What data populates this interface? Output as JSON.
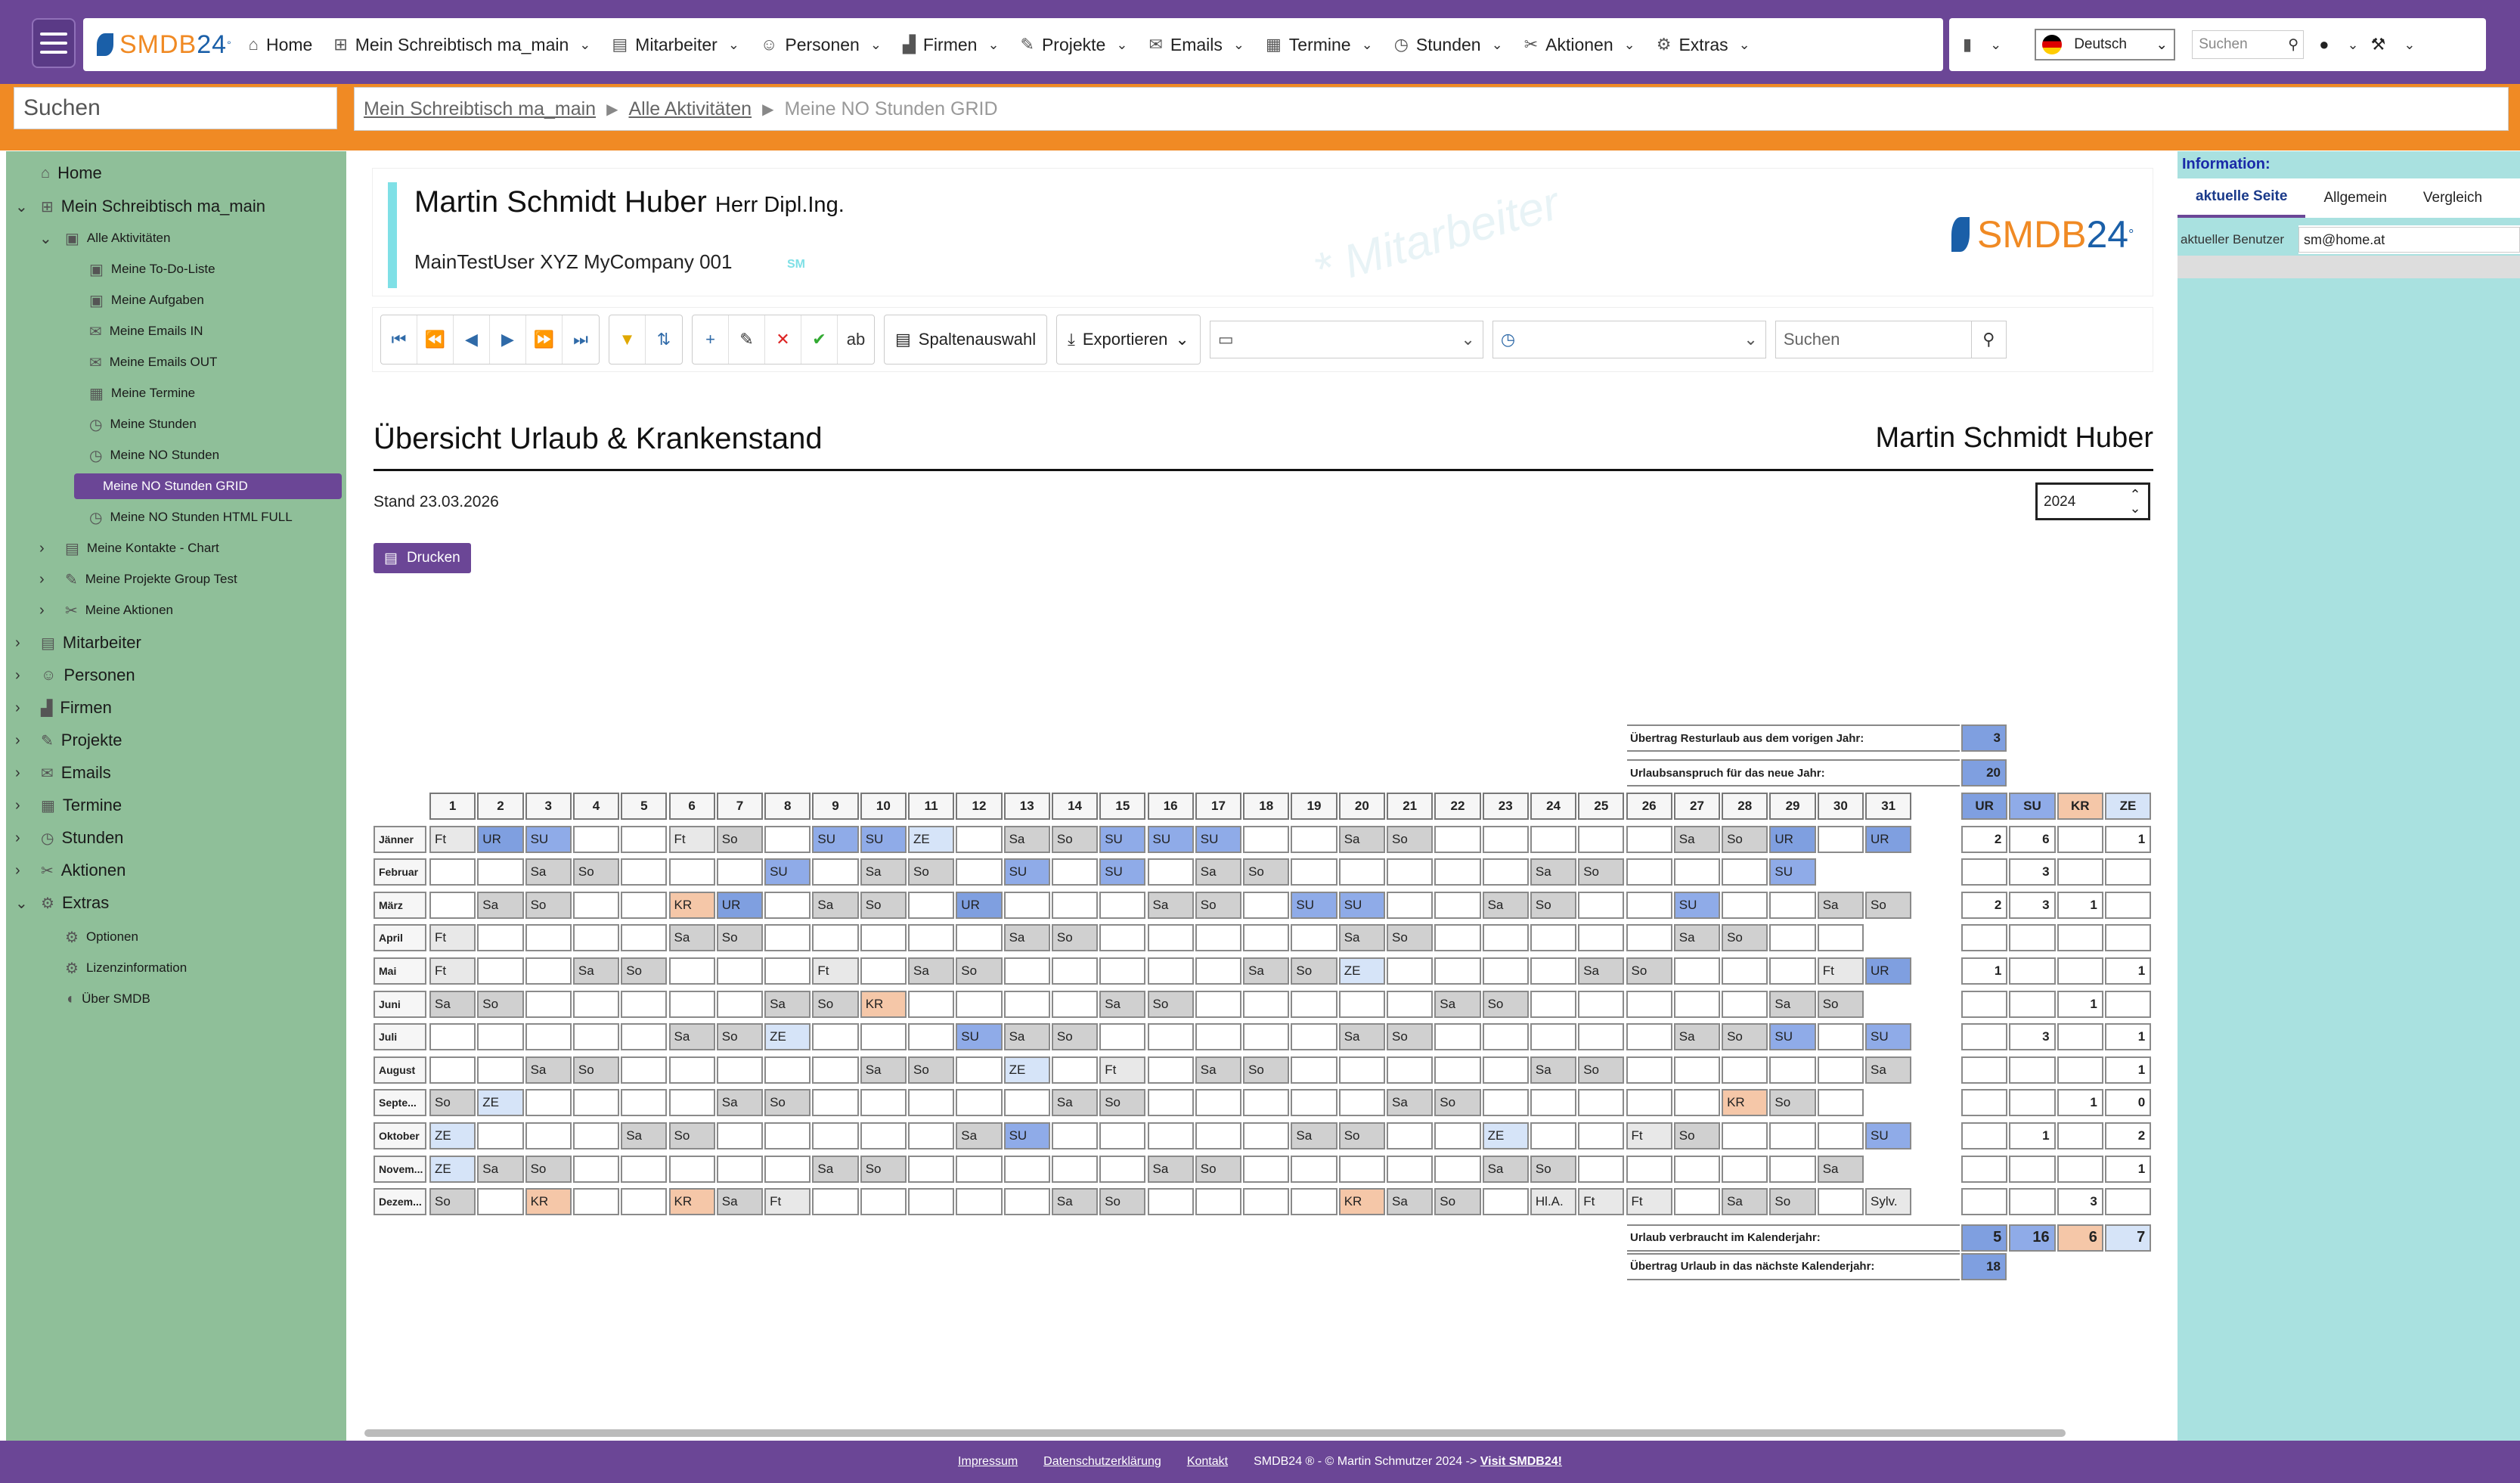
{
  "topnav": {
    "logo": {
      "text": "SMDB",
      "num": "24",
      "sup": "°"
    },
    "items": [
      {
        "label": "Home",
        "icon": "home-icon",
        "glyph": "⌂",
        "chevron": false
      },
      {
        "label": "Mein Schreibtisch ma_main",
        "icon": "desk-icon",
        "glyph": "⊞",
        "chevron": true
      },
      {
        "label": "Mitarbeiter",
        "icon": "employee-icon",
        "glyph": "▤",
        "chevron": true
      },
      {
        "label": "Personen",
        "icon": "people-icon",
        "glyph": "☺",
        "chevron": true
      },
      {
        "label": "Firmen",
        "icon": "factory-icon",
        "glyph": "▟",
        "chevron": true
      },
      {
        "label": "Projekte",
        "icon": "projects-icon",
        "glyph": "✎",
        "chevron": true
      },
      {
        "label": "Emails",
        "icon": "email-icon",
        "glyph": "✉",
        "chevron": true
      },
      {
        "label": "Termine",
        "icon": "calendar-icon",
        "glyph": "▦",
        "chevron": true
      },
      {
        "label": "Stunden",
        "icon": "clock-icon",
        "glyph": "◷",
        "chevron": true
      },
      {
        "label": "Aktionen",
        "icon": "actions-icon",
        "glyph": "✂",
        "chevron": true
      },
      {
        "label": "Extras",
        "icon": "gear-icon",
        "glyph": "⚙",
        "chevron": true
      }
    ],
    "language": "Deutsch",
    "search_placeholder": "Suchen"
  },
  "left_search_placeholder": "Suchen",
  "breadcrumb": {
    "items": [
      "Mein Schreibtisch ma_main",
      "Alle Aktivitäten"
    ],
    "current": "Meine NO Stunden GRID"
  },
  "sidebar": {
    "items": [
      {
        "label": "Home",
        "level": 0,
        "icon": "home-icon",
        "glyph": "⌂",
        "exp": ""
      },
      {
        "label": "Mein Schreibtisch ma_main",
        "level": 0,
        "icon": "desk-icon",
        "glyph": "⊞",
        "exp": "⌄"
      },
      {
        "label": "Alle Aktivitäten",
        "level": 1,
        "icon": "activities-icon",
        "glyph": "▣",
        "exp": "⌄"
      },
      {
        "label": "Meine To-Do-Liste",
        "level": 2,
        "icon": "todo-icon",
        "glyph": "▣",
        "exp": ""
      },
      {
        "label": "Meine Aufgaben",
        "level": 2,
        "icon": "tasks-icon",
        "glyph": "▣",
        "exp": ""
      },
      {
        "label": "Meine Emails IN",
        "level": 2,
        "icon": "email-in-icon",
        "glyph": "✉",
        "exp": ""
      },
      {
        "label": "Meine Emails OUT",
        "level": 2,
        "icon": "email-out-icon",
        "glyph": "✉",
        "exp": ""
      },
      {
        "label": "Meine Termine",
        "level": 2,
        "icon": "calendar-icon",
        "glyph": "▦",
        "exp": ""
      },
      {
        "label": "Meine Stunden",
        "level": 2,
        "icon": "clock-icon",
        "glyph": "◷",
        "exp": ""
      },
      {
        "label": "Meine NO Stunden",
        "level": 2,
        "icon": "clock-icon",
        "glyph": "◷",
        "exp": ""
      },
      {
        "label": "Meine NO Stunden GRID",
        "level": 2,
        "icon": "",
        "glyph": "",
        "exp": "",
        "active": true
      },
      {
        "label": "Meine NO Stunden HTML FULL",
        "level": 2,
        "icon": "clock-icon",
        "glyph": "◷",
        "exp": ""
      },
      {
        "label": "Meine Kontakte - Chart",
        "level": 1,
        "icon": "contacts-icon",
        "glyph": "▤",
        "exp": "›"
      },
      {
        "label": "Meine Projekte Group Test",
        "level": 1,
        "icon": "projects-icon",
        "glyph": "✎",
        "exp": "›"
      },
      {
        "label": "Meine Aktionen",
        "level": 1,
        "icon": "actions-icon",
        "glyph": "✂",
        "exp": "›"
      },
      {
        "label": "Mitarbeiter",
        "level": 0,
        "icon": "employee-icon",
        "glyph": "▤",
        "exp": "›"
      },
      {
        "label": "Personen",
        "level": 0,
        "icon": "people-icon",
        "glyph": "☺",
        "exp": "›"
      },
      {
        "label": "Firmen",
        "level": 0,
        "icon": "factory-icon",
        "glyph": "▟",
        "exp": "›"
      },
      {
        "label": "Projekte",
        "level": 0,
        "icon": "projects-icon",
        "glyph": "✎",
        "exp": "›"
      },
      {
        "label": "Emails",
        "level": 0,
        "icon": "email-icon",
        "glyph": "✉",
        "exp": "›"
      },
      {
        "label": "Termine",
        "level": 0,
        "icon": "calendar-icon",
        "glyph": "▦",
        "exp": "›"
      },
      {
        "label": "Stunden",
        "level": 0,
        "icon": "clock-icon",
        "glyph": "◷",
        "exp": "›"
      },
      {
        "label": "Aktionen",
        "level": 0,
        "icon": "actions-icon",
        "glyph": "✂",
        "exp": "›"
      },
      {
        "label": "Extras",
        "level": 0,
        "icon": "gear-icon",
        "glyph": "⚙",
        "exp": "⌄"
      },
      {
        "label": "Optionen",
        "level": 1,
        "icon": "options-icon",
        "glyph": "⚙",
        "exp": ""
      },
      {
        "label": "Lizenzinformation",
        "level": 1,
        "icon": "license-icon",
        "glyph": "⚙",
        "exp": ""
      },
      {
        "label": "Über SMDB",
        "level": 1,
        "icon": "dolphin-icon",
        "glyph": "◖",
        "exp": ""
      }
    ]
  },
  "employee": {
    "name": "Martin Schmidt Huber",
    "title": "Herr Dipl.Ing.",
    "subtitle": "MainTestUser XYZ MyCompany 001",
    "initials": "SM",
    "watermark": "* Mitarbeiter",
    "logo": {
      "text": "SMDB",
      "num": "24",
      "sup": "°"
    }
  },
  "toolbar": {
    "columns_label": "Spaltenauswahl",
    "export_label": "Exportieren",
    "search_placeholder": "Suchen"
  },
  "report": {
    "title": "Übersicht Urlaub & Krankenstand",
    "employee": "Martin Schmidt Huber",
    "stand": "Stand 23.03.2026",
    "year": "2024",
    "print_label": "Drucken",
    "carry_prev_label": "Übertrag Resturlaub aus dem vorigen Jahr:",
    "carry_prev": "3",
    "entitlement_label": "Urlaubsanspruch für das neue Jahr:",
    "entitlement": "20",
    "used_label": "Urlaub verbraucht im Kalenderjahr:",
    "totals": [
      "5",
      "16",
      "6",
      "7"
    ],
    "carry_next_label": "Übertrag Urlaub in das nächste Kalenderjahr:",
    "carry_next": "18",
    "sum_headers": [
      "UR",
      "SU",
      "KR",
      "ZE"
    ],
    "months": [
      {
        "name": "Jänner",
        "days": [
          "Ft",
          "UR",
          "SU",
          "",
          "",
          "Ft",
          "So",
          "",
          "SU",
          "SU",
          "ZE",
          "",
          "Sa",
          "So",
          "SU",
          "SU",
          "SU",
          "",
          "",
          "Sa",
          "So",
          "",
          "",
          "",
          "",
          "",
          "Sa",
          "So",
          "UR",
          "",
          "UR"
        ],
        "sums": [
          "2",
          "6",
          "",
          "1"
        ]
      },
      {
        "name": "Februar",
        "days": [
          "",
          "",
          "Sa",
          "So",
          "",
          "",
          "",
          "SU",
          "",
          "Sa",
          "So",
          "",
          "SU",
          "",
          "SU",
          "",
          "Sa",
          "So",
          "",
          "",
          "",
          "",
          "",
          "Sa",
          "So",
          "",
          "",
          "",
          "SU",
          "-",
          "-"
        ],
        "sums": [
          "",
          "3",
          "",
          ""
        ]
      },
      {
        "name": "März",
        "days": [
          "",
          "Sa",
          "So",
          "",
          "",
          "KR",
          "UR",
          "",
          "Sa",
          "So",
          "",
          "UR",
          "",
          "",
          "",
          "Sa",
          "So",
          "",
          "SU",
          "SU",
          "",
          "",
          "Sa",
          "So",
          "",
          "",
          "SU",
          "",
          "",
          "Sa",
          "So"
        ],
        "sums": [
          "2",
          "3",
          "1",
          ""
        ]
      },
      {
        "name": "April",
        "days": [
          "Ft",
          "",
          "",
          "",
          "",
          "Sa",
          "So",
          "",
          "",
          "",
          "",
          "",
          "Sa",
          "So",
          "",
          "",
          "",
          "",
          "",
          "Sa",
          "So",
          "",
          "",
          "",
          "",
          "",
          "Sa",
          "So",
          "",
          "",
          "-"
        ],
        "sums": [
          "",
          "",
          "",
          ""
        ]
      },
      {
        "name": "Mai",
        "days": [
          "Ft",
          "",
          "",
          "Sa",
          "So",
          "",
          "",
          "",
          "Ft",
          "",
          "Sa",
          "So",
          "",
          "",
          "",
          "",
          "",
          "Sa",
          "So",
          "ZE",
          "",
          "",
          "",
          "",
          "Sa",
          "So",
          "",
          "",
          "",
          "Ft",
          "UR"
        ],
        "sums": [
          "1",
          "",
          "",
          "1"
        ]
      },
      {
        "name": "Juni",
        "days": [
          "Sa",
          "So",
          "",
          "",
          "",
          "",
          "",
          "Sa",
          "So",
          "KR",
          "",
          "",
          "",
          "",
          "Sa",
          "So",
          "",
          "",
          "",
          "",
          "",
          "Sa",
          "So",
          "",
          "",
          "",
          "",
          "",
          "Sa",
          "So",
          "-"
        ],
        "sums": [
          "",
          "",
          "1",
          ""
        ]
      },
      {
        "name": "Juli",
        "days": [
          "",
          "",
          "",
          "",
          "",
          "Sa",
          "So",
          "ZE",
          "",
          "",
          "",
          "SU",
          "Sa",
          "So",
          "",
          "",
          "",
          "",
          "",
          "Sa",
          "So",
          "",
          "",
          "",
          "",
          "",
          "Sa",
          "So",
          "SU",
          "",
          "SU"
        ],
        "sums": [
          "",
          "3",
          "",
          "1"
        ]
      },
      {
        "name": "August",
        "days": [
          "",
          "",
          "Sa",
          "So",
          "",
          "",
          "",
          "",
          "",
          "Sa",
          "So",
          "",
          "ZE",
          "",
          "Ft",
          "",
          "Sa",
          "So",
          "",
          "",
          "",
          "",
          "",
          "Sa",
          "So",
          "",
          "",
          "",
          "",
          "",
          "Sa"
        ],
        "sums": [
          "",
          "",
          "",
          "1"
        ]
      },
      {
        "name": "Septe...",
        "days": [
          "So",
          "ZE",
          "",
          "",
          "",
          "",
          "Sa",
          "So",
          "",
          "",
          "",
          "",
          "",
          "Sa",
          "So",
          "",
          "",
          "",
          "",
          "",
          "Sa",
          "So",
          "",
          "",
          "",
          "",
          "",
          "KR",
          "So",
          "",
          "-"
        ],
        "sums": [
          "",
          "",
          "1",
          "0"
        ]
      },
      {
        "name": "Oktober",
        "days": [
          "ZE",
          "",
          "",
          "",
          "Sa",
          "So",
          "",
          "",
          "",
          "",
          "",
          "Sa",
          "SU",
          "",
          "",
          "",
          "",
          "",
          "Sa",
          "So",
          "",
          "",
          "ZE",
          "",
          "",
          "Ft",
          "So",
          "",
          "",
          "",
          "SU"
        ],
        "sums": [
          "",
          "1",
          "",
          "2"
        ]
      },
      {
        "name": "Novem...",
        "days": [
          "ZE",
          "Sa",
          "So",
          "",
          "",
          "",
          "",
          "",
          "Sa",
          "So",
          "",
          "",
          "",
          "",
          "",
          "Sa",
          "So",
          "",
          "",
          "",
          "",
          "",
          "Sa",
          "So",
          "",
          "",
          "",
          "",
          "",
          "Sa",
          "-"
        ],
        "sums": [
          "",
          "",
          "",
          "1"
        ]
      },
      {
        "name": "Dezem...",
        "days": [
          "So",
          "",
          "KR",
          "",
          "",
          "KR",
          "Sa",
          "Ft",
          "",
          "",
          "",
          "",
          "",
          "Sa",
          "So",
          "",
          "",
          "",
          "",
          "KR",
          "Sa",
          "So",
          "",
          "Hl.A.",
          "Ft",
          "Ft",
          "",
          "Sa",
          "So",
          "",
          "Sylv."
        ],
        "sums": [
          "",
          "",
          "3",
          ""
        ]
      }
    ]
  },
  "right_panel": {
    "title": "Information:",
    "tabs": [
      "aktuelle Seite",
      "Allgemein",
      "Vergleich"
    ],
    "row_key": "aktueller Benutzer",
    "row_value": "sm@home.at"
  },
  "footer": {
    "links": [
      "Impressum",
      "Datenschutzerklärung",
      "Kontakt"
    ],
    "copyright": "SMDB24 ® - © Martin Schmutzer 2024 ->",
    "visit": "Visit SMDB24!"
  },
  "colors": {
    "brand_purple": "#6b4696",
    "brand_orange": "#f08a24",
    "sidebar_green": "#8fbf99",
    "panel_cyan": "#a9e1e0",
    "ur": "#7f9fe0",
    "kr": "#f5c7a8",
    "ze": "#d6e4f8"
  }
}
